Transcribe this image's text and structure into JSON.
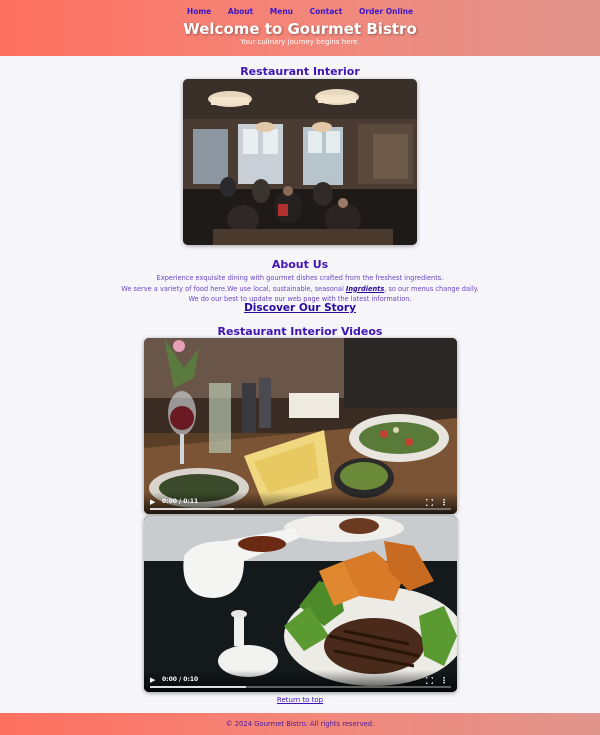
{
  "nav": {
    "items": [
      {
        "label": "Home"
      },
      {
        "label": "About"
      },
      {
        "label": "Menu"
      },
      {
        "label": "Contact"
      },
      {
        "label": "Order Online"
      }
    ]
  },
  "header": {
    "title": "Welcome to Gourmet Bistro",
    "tagline": "Your culinary journey begins here."
  },
  "interior": {
    "heading": "Restaurant Interior"
  },
  "about": {
    "heading": "About Us",
    "line1": "Experience exquisite dining with gourmet dishes crafted from the freshest ingredients.",
    "line2_before": "We serve a variety of food here.We use local, sustainable, seasonal ",
    "line2_link": "Ingrdients",
    "line2_after": ", so our menus change daily.",
    "line3": "We do our best to update our web page with the latest information."
  },
  "discover": {
    "label": "Discover Our Story"
  },
  "videos": {
    "heading": "Restaurant Interior Videos",
    "items": [
      {
        "time": "0:00 / 0:11",
        "progress": 0.28
      },
      {
        "time": "0:00 / 0:10",
        "progress": 0.32
      }
    ]
  },
  "return_top": {
    "label": "Return to top"
  },
  "footer": {
    "text": "© 2024 Gourmet Bistro. All rights reserved."
  },
  "colors": {
    "header_gradient_start": "#fe7060",
    "header_gradient_end": "#e0958c",
    "heading": "#3f14b3",
    "nav_link": "#3a16c8"
  }
}
